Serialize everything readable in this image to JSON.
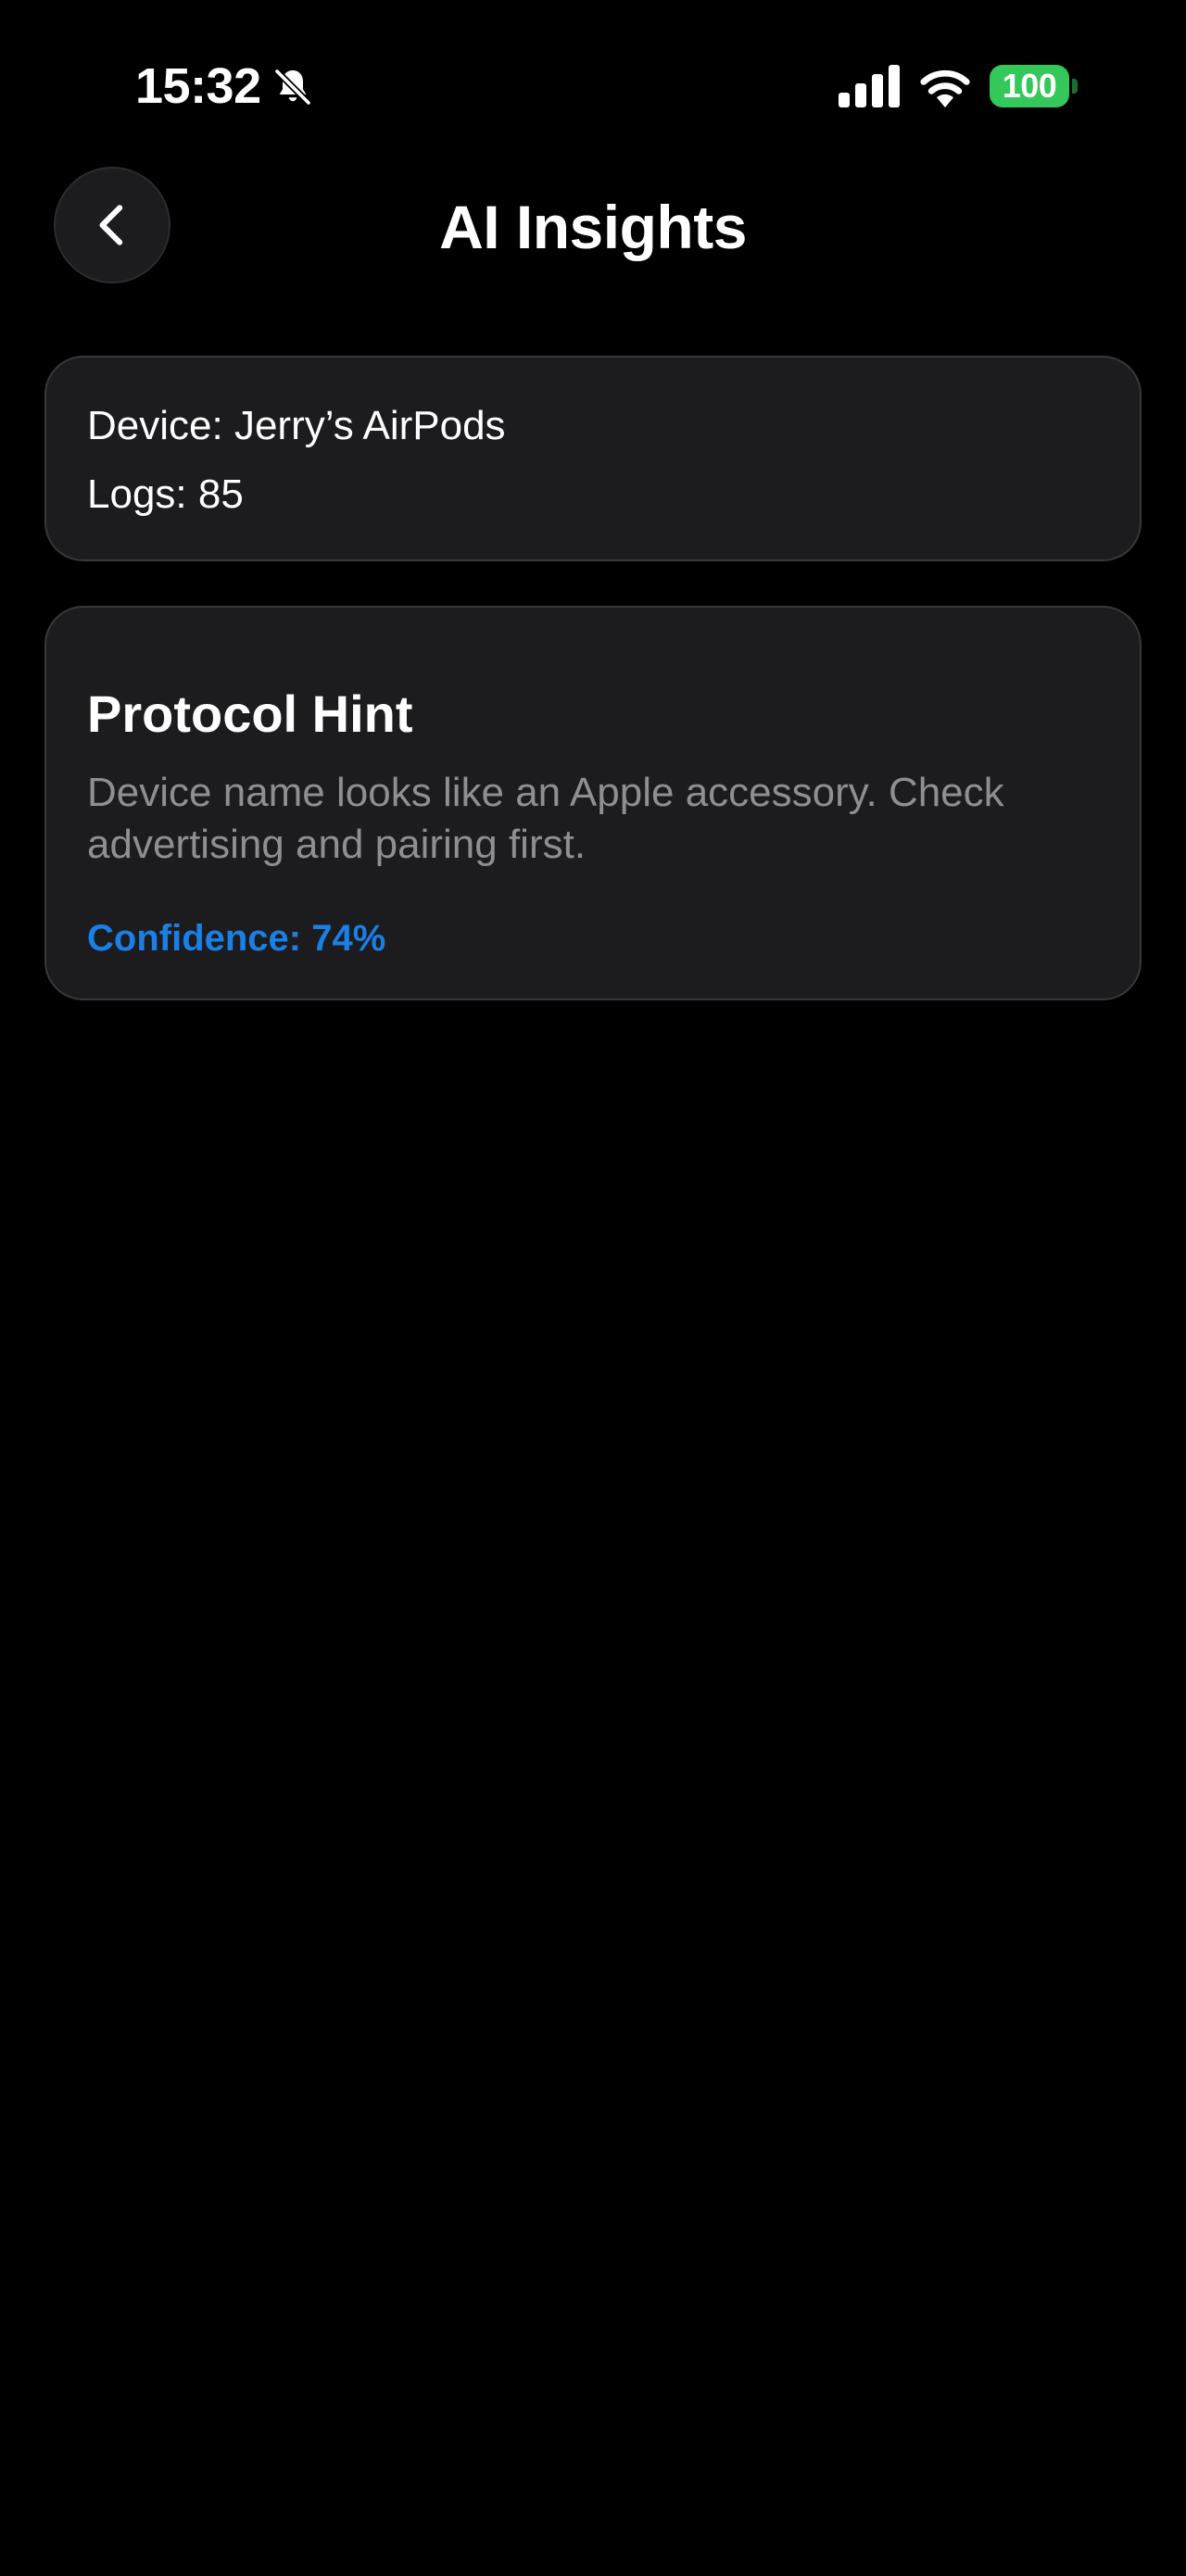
{
  "status_bar": {
    "time": "15:32",
    "battery_level": "100",
    "silent_mode": true,
    "icons": {
      "bell": "bell-slash-icon",
      "signal": "cellular-signal-icon",
      "wifi": "wifi-icon"
    }
  },
  "nav": {
    "title": "AI Insights",
    "back_icon": "chevron-left-icon"
  },
  "device_card": {
    "device_line": "Device: Jerry’s AirPods",
    "logs_line": "Logs: 85"
  },
  "hint_card": {
    "title": "Protocol Hint",
    "body": "Device name looks like an Apple accessory. Check advertising and pairing first.",
    "confidence": "Confidence: 74%"
  },
  "colors": {
    "background": "#000000",
    "card_background": "#1c1c1e",
    "card_border": "#38383a",
    "secondary_text": "#8e8e93",
    "accent_blue": "#1a7fe6",
    "battery_green": "#34c759"
  }
}
